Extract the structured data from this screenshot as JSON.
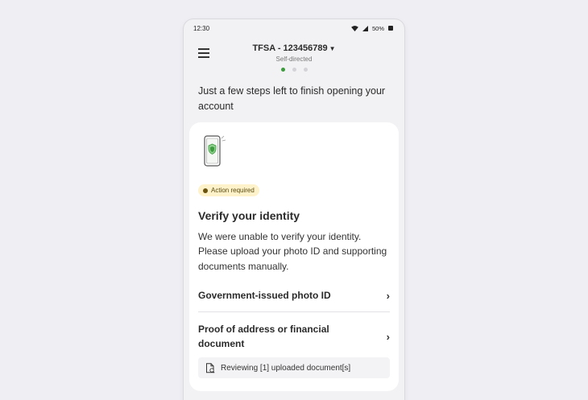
{
  "status_bar": {
    "time": "12:30",
    "battery": "50%"
  },
  "header": {
    "account_title": "TFSA - 123456789",
    "account_subtitle": "Self-directed",
    "step_dots": [
      {
        "active": true
      },
      {
        "active": false
      },
      {
        "active": false
      }
    ]
  },
  "intro_text": "Just a few steps left to finish opening your account",
  "card": {
    "badge": "Action required",
    "title": "Verify your identity",
    "body": "We were unable to verify your identity. Please upload your photo ID and supporting documents manually.",
    "items": [
      {
        "label": "Government-issued photo ID"
      },
      {
        "label": "Proof of address or financial document"
      }
    ],
    "review_note": "Reviewing [1] uploaded document[s]"
  },
  "colors": {
    "accent_green": "#3d9a3e",
    "badge_bg": "#fdf2c9",
    "background": "#eeeef3"
  },
  "icons": [
    "menu-icon",
    "caret-down-icon",
    "wifi-icon",
    "signal-icon",
    "battery-icon",
    "phone-shield-illustration",
    "chevron-right-icon",
    "document-review-icon"
  ]
}
